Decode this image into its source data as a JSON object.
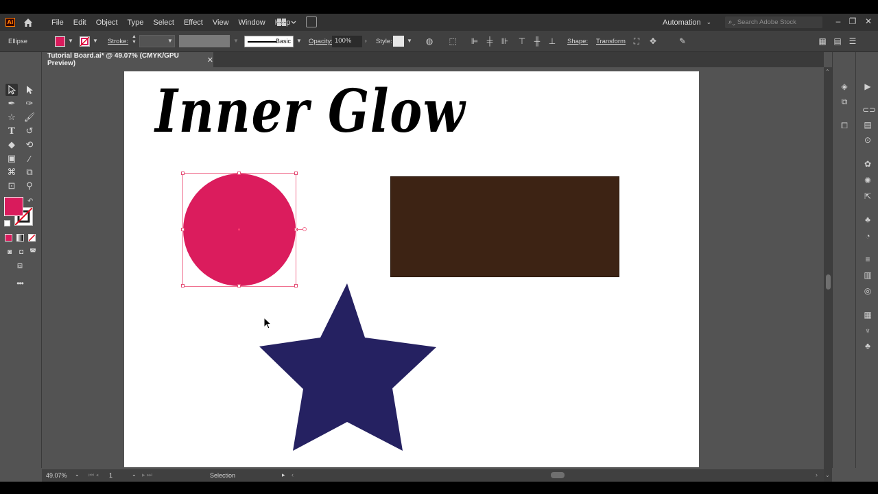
{
  "app": {
    "logo": "Ai"
  },
  "menu": [
    "File",
    "Edit",
    "Object",
    "Type",
    "Select",
    "Effect",
    "View",
    "Window",
    "Help"
  ],
  "header": {
    "workspace": "Automation",
    "search_placeholder": "Search Adobe Stock"
  },
  "control_bar": {
    "selection_type": "Ellipse",
    "fill_color": "#d91b5c",
    "stroke_label": "Stroke:",
    "brush_label": "Basic",
    "opacity_label": "Opacity:",
    "opacity_value": "100%",
    "style_label": "Style:",
    "shape_label": "Shape:",
    "transform_label": "Transform"
  },
  "document": {
    "tab_title": "Tutorial Board.ai* @ 49.07% (CMYK/GPU Preview)"
  },
  "artboard": {
    "title": "Inner Glow",
    "circle_color": "#db1c5d",
    "rect_color": "#3d2314",
    "star_color": "#252161"
  },
  "status_bar": {
    "zoom": "49.07%",
    "page": "1",
    "tool": "Selection"
  },
  "icons": {
    "toolbar": [
      "selection-icon",
      "direct-selection-icon",
      "pen-icon",
      "curvature-icon",
      "star-icon",
      "paintbrush-icon",
      "type-icon",
      "rotate-icon",
      "eraser-icon",
      "free-transform-icon",
      "gradient-icon",
      "eyedropper-icon",
      "blend-icon",
      "shape-builder-icon",
      "artboard-icon",
      "zoom-icon"
    ],
    "dock": [
      "layers-icon",
      "libraries-icon",
      "properties-icon",
      "actions-icon",
      "links-icon",
      "asset-export-icon",
      "symbols-icon",
      "appearance-icon",
      "graphic-styles-icon",
      "stroke-icon",
      "gradient-panel-icon",
      "transparency-icon",
      "align-icon",
      "color-guide-icon",
      "swatches-icon",
      "brushes-icon"
    ]
  }
}
